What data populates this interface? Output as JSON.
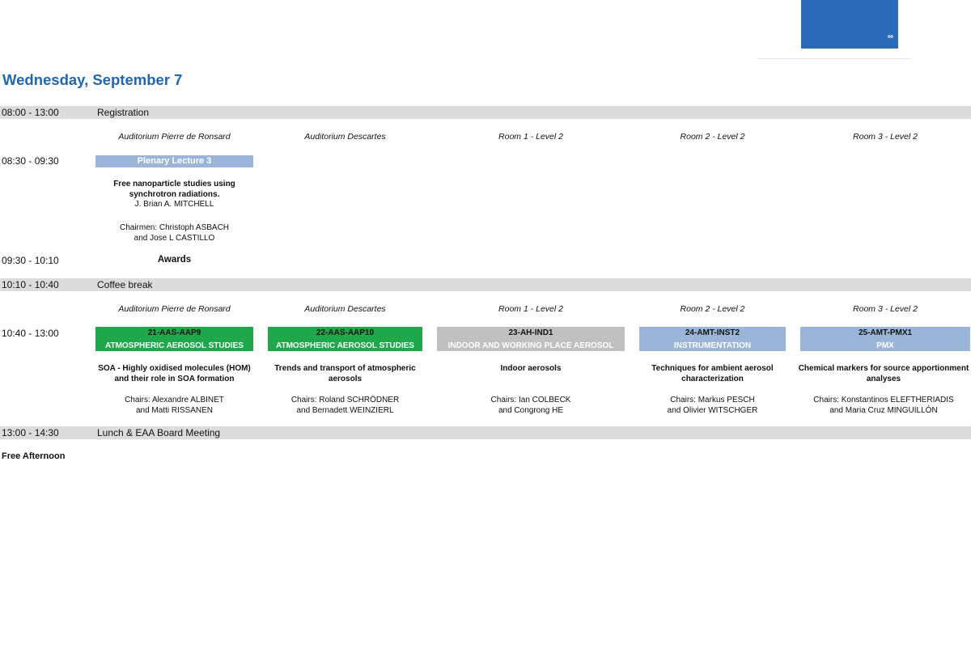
{
  "corner": {
    "glyph": "∞"
  },
  "day_title": "Wednesday, September 7",
  "rows": {
    "registration": {
      "time": "08:00 - 13:00",
      "label": "Registration"
    },
    "plenary": {
      "time": "08:30 - 09:30"
    },
    "awards": {
      "time": "09:30 - 10:10",
      "label": "Awards"
    },
    "coffee": {
      "time": "10:10 - 10:40",
      "label": "Coffee break"
    },
    "sessions": {
      "time": "10:40 - 13:00"
    },
    "lunch": {
      "time": "13:00 - 14:30",
      "label": "Lunch & EAA Board Meeting"
    }
  },
  "rooms": [
    "Auditorium Pierre de Ronsard",
    "Auditorium Descartes",
    "Room 1 - Level 2",
    "Room 2 - Level 2",
    "Room 3 - Level 2"
  ],
  "plenary": {
    "label": "Plenary Lecture 3",
    "title_line1": "Free nanoparticle studies using",
    "title_line2": "synchrotron radiations.",
    "speaker": "J. Brian A. MITCHELL",
    "chair_line1": "Chairmen: Christoph ASBACH",
    "chair_line2": "and Jose L CASTILLO"
  },
  "sessions": [
    {
      "code": "21-AAS-AAP9",
      "theme": "ATMOSPHERIC AEROSOL STUDIES",
      "color": "#1fa84b",
      "title_line1": "SOA - Highly oxidised molecules (HOM)",
      "title_line2": "and their role in SOA formation",
      "chair_line1": "Chairs: Alexandre ALBINET",
      "chair_line2": "and Matti RISSANEN"
    },
    {
      "code": "22-AAS-AAP10",
      "theme": "ATMOSPHERIC AEROSOL STUDIES",
      "color": "#1fa84b",
      "title_line1": "Trends and transport of atmospheric",
      "title_line2": "aerosols",
      "chair_line1": "Chairs: Roland SCHRÖDNER",
      "chair_line2": "and Bernadett WEINZIERL"
    },
    {
      "code": "23-AH-IND1",
      "theme": "INDOOR AND WORKING PLACE AEROSOL",
      "color": "#c0c0c0",
      "title_line1": "Indoor aerosols",
      "title_line2": "",
      "chair_line1": "Chairs: Ian COLBECK",
      "chair_line2": "and Congrong HE"
    },
    {
      "code": "24-AMT-INST2",
      "theme": "INSTRUMENTATION",
      "color": "#9ab5d8",
      "title_line1": "Techniques for ambient aerosol",
      "title_line2": "characterization",
      "chair_line1": "Chairs: Markus PESCH",
      "chair_line2": "and Olivier WITSCHGER"
    },
    {
      "code": "25-AMT-PMX1",
      "theme": "PMX",
      "color": "#9ab5d8",
      "title_line1": "Chemical markers for source apportionment",
      "title_line2": "analyses",
      "chair_line1": "Chairs: Konstantinos ELEFTHERIADIS",
      "chair_line2": "and Maria Cruz MINGUILLÓN"
    }
  ],
  "free_afternoon": "Free Afternoon"
}
